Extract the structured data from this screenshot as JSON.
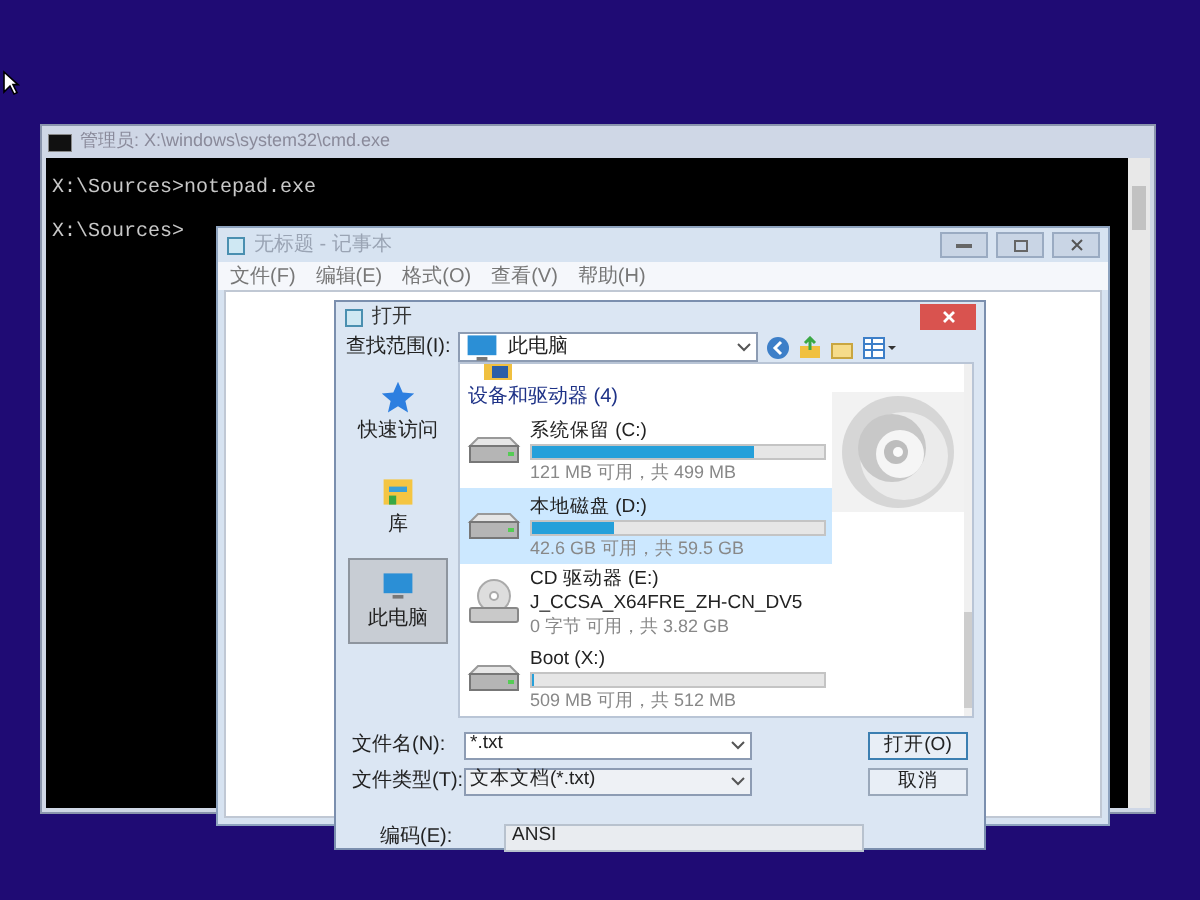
{
  "cmd": {
    "title": "管理员: X:\\windows\\system32\\cmd.exe",
    "lines": [
      "X:\\Sources>notepad.exe",
      "X:\\Sources>"
    ]
  },
  "notepad": {
    "title": "无标题 - 记事本",
    "menu": [
      "文件(F)",
      "编辑(E)",
      "格式(O)",
      "查看(V)",
      "帮助(H)"
    ]
  },
  "dialog": {
    "title": "打开",
    "look_in_label": "查找范围(I):",
    "look_in": "此电脑",
    "places": [
      {
        "kind": "star",
        "label": "快速访问",
        "selected": false
      },
      {
        "kind": "library",
        "label": "库",
        "selected": false
      },
      {
        "kind": "pc",
        "label": "此电脑",
        "selected": true
      }
    ],
    "group": "设备和驱动器 (4)",
    "drives": [
      {
        "kind": "disk",
        "name": "系统保留 (C:)",
        "level": 0.76,
        "space": "121 MB 可用，共 499 MB",
        "selected": false
      },
      {
        "kind": "disk",
        "name": "本地磁盘 (D:)",
        "level": 0.28,
        "space": "42.6 GB 可用，共 59.5 GB",
        "selected": true
      },
      {
        "kind": "cd",
        "name": "CD 驱动器 (E:)",
        "volume": "J_CCSA_X64FRE_ZH-CN_DV5",
        "space": "0 字节 可用，共 3.82 GB",
        "selected": false
      },
      {
        "kind": "disk",
        "name": "Boot (X:)",
        "level": 0.01,
        "space": "509 MB 可用，共 512 MB",
        "selected": false
      }
    ],
    "file_name_label": "文件名(N):",
    "file_name": "*.txt",
    "file_type_label": "文件类型(T):",
    "file_type": "文本文档(*.txt)",
    "open": "打开(O)",
    "cancel": "取消",
    "encoding_label": "编码(E):",
    "encoding": "ANSI"
  }
}
